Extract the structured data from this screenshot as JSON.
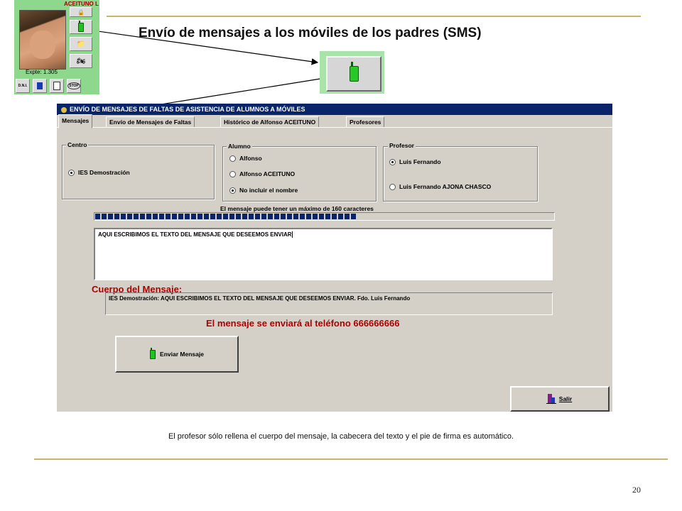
{
  "slide": {
    "title": "Envío de mensajes a los móviles de los padres (SMS)",
    "caption": "El profesor sólo rellena el cuerpo del mensaje, la cabecera del texto y el pie de firma es automático.",
    "page_number": "20",
    "rule_color": "#c9b46a"
  },
  "student_panel": {
    "name": "ACEITUNO L",
    "expte": "Expte: 1.305",
    "tools": [
      "lock-icon",
      "phone-icon",
      "folder-icon",
      "motorbike-icon"
    ],
    "bottom_buttons": [
      "dni-icon",
      "book-icon",
      "document-icon",
      "stop-icon"
    ],
    "dni_label": "D.N.I.",
    "stop_label": "STOP"
  },
  "app": {
    "window_title": "ENVÍO DE MENSAJES DE FALTAS DE ASISTENCIA DE ALUMNOS  A MÓVILES",
    "tabs": [
      {
        "label": "Mensajes",
        "active": true
      },
      {
        "label": "Envío de Mensajes de Faltas",
        "active": false
      },
      {
        "label": "Histórico de Alfonso ACEITUNO",
        "active": false
      },
      {
        "label": "Profesores",
        "active": false
      }
    ],
    "centro": {
      "label": "Centro",
      "options": [
        {
          "label": "IES Demostración",
          "selected": true
        }
      ]
    },
    "alumno": {
      "label": "Alumno",
      "options": [
        {
          "label": "Alfonso",
          "selected": false
        },
        {
          "label": "Alfonso ACEITUNO",
          "selected": false
        },
        {
          "label": "No incluir el nombre",
          "selected": true
        }
      ]
    },
    "profesor": {
      "label": "Profesor",
      "options": [
        {
          "label": "Luis Fernando",
          "selected": true
        },
        {
          "label": "Luis Fernando AJONA  CHASCO",
          "selected": false
        }
      ]
    },
    "max_chars_text": "El mensaje puede tener un máximo de 160 caracteres",
    "progress_fraction": 0.57,
    "message_text": "AQUI ESCRIBIMOS EL TEXTO DEL MENSAJE QUE DESEEMOS ENVIAR",
    "cuerpo_label": "Cuerpo del Mensaje:",
    "cuerpo_text": "IES Demostración: AQUI ESCRIBIMOS EL TEXTO DEL MENSAJE QUE DESEEMOS ENVIAR. Fdo. Luis Fernando",
    "phone_line": "El mensaje se enviará al teléfono 666666666",
    "send_button": "Enviar Mensaje",
    "exit_button": "Salir",
    "accent_red": "#b00000",
    "titlebar_color": "#0a246a"
  }
}
